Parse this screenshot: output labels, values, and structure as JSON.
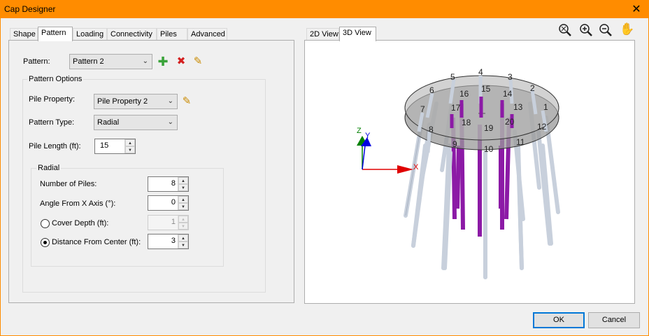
{
  "window": {
    "title": "Cap Designer",
    "close_glyph": "✕"
  },
  "left_tabs": [
    "Shape",
    "Pattern",
    "Loading",
    "Connectivity",
    "Piles",
    "Advanced"
  ],
  "active_left_tab": "Pattern",
  "view_tabs": [
    "2D View",
    "3D View"
  ],
  "active_view_tab": "3D View",
  "toolbar_icons": [
    "zoom-extents-icon",
    "zoom-in-icon",
    "zoom-out-icon",
    "pan-hand-icon"
  ],
  "pattern": {
    "label": "Pattern:",
    "value": "Pattern 2",
    "icons": {
      "add": "add-icon",
      "delete": "delete-icon",
      "edit": "pencil-icon"
    }
  },
  "pattern_options": {
    "title": "Pattern Options",
    "pile_property": {
      "label": "Pile Property:",
      "value": "Pile Property 2"
    },
    "pattern_type": {
      "label": "Pattern Type:",
      "value": "Radial"
    },
    "pile_length": {
      "label": "Pile Length (ft):",
      "value": "15"
    }
  },
  "radial": {
    "title": "Radial",
    "number_of_piles": {
      "label": "Number of Piles:",
      "value": "8"
    },
    "angle_from_x": {
      "label": "Angle From X Axis (°):",
      "value": "0"
    },
    "cover_depth": {
      "label": "Cover Depth (ft):",
      "value": "1",
      "selected": false
    },
    "distance_from_center": {
      "label": "Distance From Center (ft):",
      "value": "3",
      "selected": true
    }
  },
  "view3d": {
    "axis_labels": {
      "x": "X",
      "y": "Y",
      "z": "Z"
    },
    "pile_numbers": [
      "1",
      "2",
      "3",
      "4",
      "5",
      "6",
      "7",
      "8",
      "9",
      "10",
      "11",
      "12",
      "13",
      "14",
      "15",
      "16",
      "17",
      "18",
      "19",
      "20"
    ],
    "colors": {
      "cap": "#b4b4b4",
      "pile_gray": "#c8d0dc",
      "pile_purple": "#8c1aa6",
      "axis_x": "#e00000",
      "axis_y": "#0000e0",
      "axis_z": "#008000"
    }
  },
  "buttons": {
    "ok": "OK",
    "cancel": "Cancel"
  }
}
